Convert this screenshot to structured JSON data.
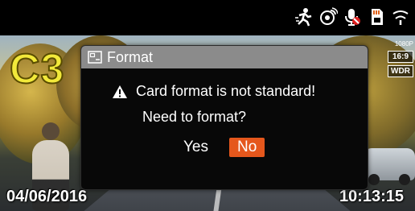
{
  "status_bar": {
    "icons": [
      "motion-detection-icon",
      "gps-signal-icon",
      "mic-muted-icon",
      "memory-card-icon",
      "parking-mode-icon"
    ]
  },
  "overlay": {
    "mode_label": "C3"
  },
  "badges": {
    "resolution": "1080P",
    "aspect": "16:9",
    "wdr": "WDR"
  },
  "dialog": {
    "title": "Format",
    "message_line1": "Card format is not standard!",
    "message_line2": "Need to format?",
    "yes_label": "Yes",
    "no_label": "No",
    "selected": "No"
  },
  "footer": {
    "date": "04/06/2016",
    "time": "10:13:15"
  },
  "colors": {
    "dialog_header": "#8b8b8b",
    "selected_button": "#e5571c",
    "mode_label": "#f2e93a"
  }
}
